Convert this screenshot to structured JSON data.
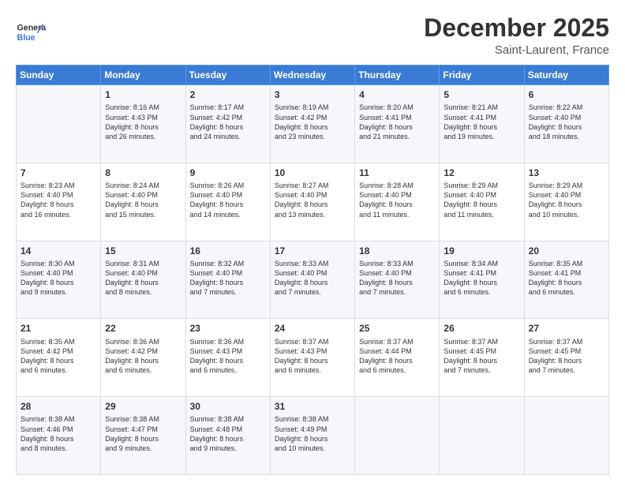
{
  "header": {
    "logo_line1": "General",
    "logo_line2": "Blue",
    "main_title": "December 2025",
    "sub_title": "Saint-Laurent, France"
  },
  "days_of_week": [
    "Sunday",
    "Monday",
    "Tuesday",
    "Wednesday",
    "Thursday",
    "Friday",
    "Saturday"
  ],
  "weeks": [
    [
      {
        "day": "",
        "info": ""
      },
      {
        "day": "1",
        "info": "Sunrise: 8:16 AM\nSunset: 4:43 PM\nDaylight: 8 hours\nand 26 minutes."
      },
      {
        "day": "2",
        "info": "Sunrise: 8:17 AM\nSunset: 4:42 PM\nDaylight: 8 hours\nand 24 minutes."
      },
      {
        "day": "3",
        "info": "Sunrise: 8:19 AM\nSunset: 4:42 PM\nDaylight: 8 hours\nand 23 minutes."
      },
      {
        "day": "4",
        "info": "Sunrise: 8:20 AM\nSunset: 4:41 PM\nDaylight: 8 hours\nand 21 minutes."
      },
      {
        "day": "5",
        "info": "Sunrise: 8:21 AM\nSunset: 4:41 PM\nDaylight: 8 hours\nand 19 minutes."
      },
      {
        "day": "6",
        "info": "Sunrise: 8:22 AM\nSunset: 4:40 PM\nDaylight: 8 hours\nand 18 minutes."
      }
    ],
    [
      {
        "day": "7",
        "info": "Sunrise: 8:23 AM\nSunset: 4:40 PM\nDaylight: 8 hours\nand 16 minutes."
      },
      {
        "day": "8",
        "info": "Sunrise: 8:24 AM\nSunset: 4:40 PM\nDaylight: 8 hours\nand 15 minutes."
      },
      {
        "day": "9",
        "info": "Sunrise: 8:26 AM\nSunset: 4:40 PM\nDaylight: 8 hours\nand 14 minutes."
      },
      {
        "day": "10",
        "info": "Sunrise: 8:27 AM\nSunset: 4:40 PM\nDaylight: 8 hours\nand 13 minutes."
      },
      {
        "day": "11",
        "info": "Sunrise: 8:28 AM\nSunset: 4:40 PM\nDaylight: 8 hours\nand 11 minutes."
      },
      {
        "day": "12",
        "info": "Sunrise: 8:29 AM\nSunset: 4:40 PM\nDaylight: 8 hours\nand 11 minutes."
      },
      {
        "day": "13",
        "info": "Sunrise: 8:29 AM\nSunset: 4:40 PM\nDaylight: 8 hours\nand 10 minutes."
      }
    ],
    [
      {
        "day": "14",
        "info": "Sunrise: 8:30 AM\nSunset: 4:40 PM\nDaylight: 8 hours\nand 9 minutes."
      },
      {
        "day": "15",
        "info": "Sunrise: 8:31 AM\nSunset: 4:40 PM\nDaylight: 8 hours\nand 8 minutes."
      },
      {
        "day": "16",
        "info": "Sunrise: 8:32 AM\nSunset: 4:40 PM\nDaylight: 8 hours\nand 7 minutes."
      },
      {
        "day": "17",
        "info": "Sunrise: 8:33 AM\nSunset: 4:40 PM\nDaylight: 8 hours\nand 7 minutes."
      },
      {
        "day": "18",
        "info": "Sunrise: 8:33 AM\nSunset: 4:40 PM\nDaylight: 8 hours\nand 7 minutes."
      },
      {
        "day": "19",
        "info": "Sunrise: 8:34 AM\nSunset: 4:41 PM\nDaylight: 8 hours\nand 6 minutes."
      },
      {
        "day": "20",
        "info": "Sunrise: 8:35 AM\nSunset: 4:41 PM\nDaylight: 8 hours\nand 6 minutes."
      }
    ],
    [
      {
        "day": "21",
        "info": "Sunrise: 8:35 AM\nSunset: 4:42 PM\nDaylight: 8 hours\nand 6 minutes."
      },
      {
        "day": "22",
        "info": "Sunrise: 8:36 AM\nSunset: 4:42 PM\nDaylight: 8 hours\nand 6 minutes."
      },
      {
        "day": "23",
        "info": "Sunrise: 8:36 AM\nSunset: 4:43 PM\nDaylight: 8 hours\nand 6 minutes."
      },
      {
        "day": "24",
        "info": "Sunrise: 8:37 AM\nSunset: 4:43 PM\nDaylight: 8 hours\nand 6 minutes."
      },
      {
        "day": "25",
        "info": "Sunrise: 8:37 AM\nSunset: 4:44 PM\nDaylight: 8 hours\nand 6 minutes."
      },
      {
        "day": "26",
        "info": "Sunrise: 8:37 AM\nSunset: 4:45 PM\nDaylight: 8 hours\nand 7 minutes."
      },
      {
        "day": "27",
        "info": "Sunrise: 8:37 AM\nSunset: 4:45 PM\nDaylight: 8 hours\nand 7 minutes."
      }
    ],
    [
      {
        "day": "28",
        "info": "Sunrise: 8:38 AM\nSunset: 4:46 PM\nDaylight: 8 hours\nand 8 minutes."
      },
      {
        "day": "29",
        "info": "Sunrise: 8:38 AM\nSunset: 4:47 PM\nDaylight: 8 hours\nand 9 minutes."
      },
      {
        "day": "30",
        "info": "Sunrise: 8:38 AM\nSunset: 4:48 PM\nDaylight: 8 hours\nand 9 minutes."
      },
      {
        "day": "31",
        "info": "Sunrise: 8:38 AM\nSunset: 4:49 PM\nDaylight: 8 hours\nand 10 minutes."
      },
      {
        "day": "",
        "info": ""
      },
      {
        "day": "",
        "info": ""
      },
      {
        "day": "",
        "info": ""
      }
    ]
  ]
}
